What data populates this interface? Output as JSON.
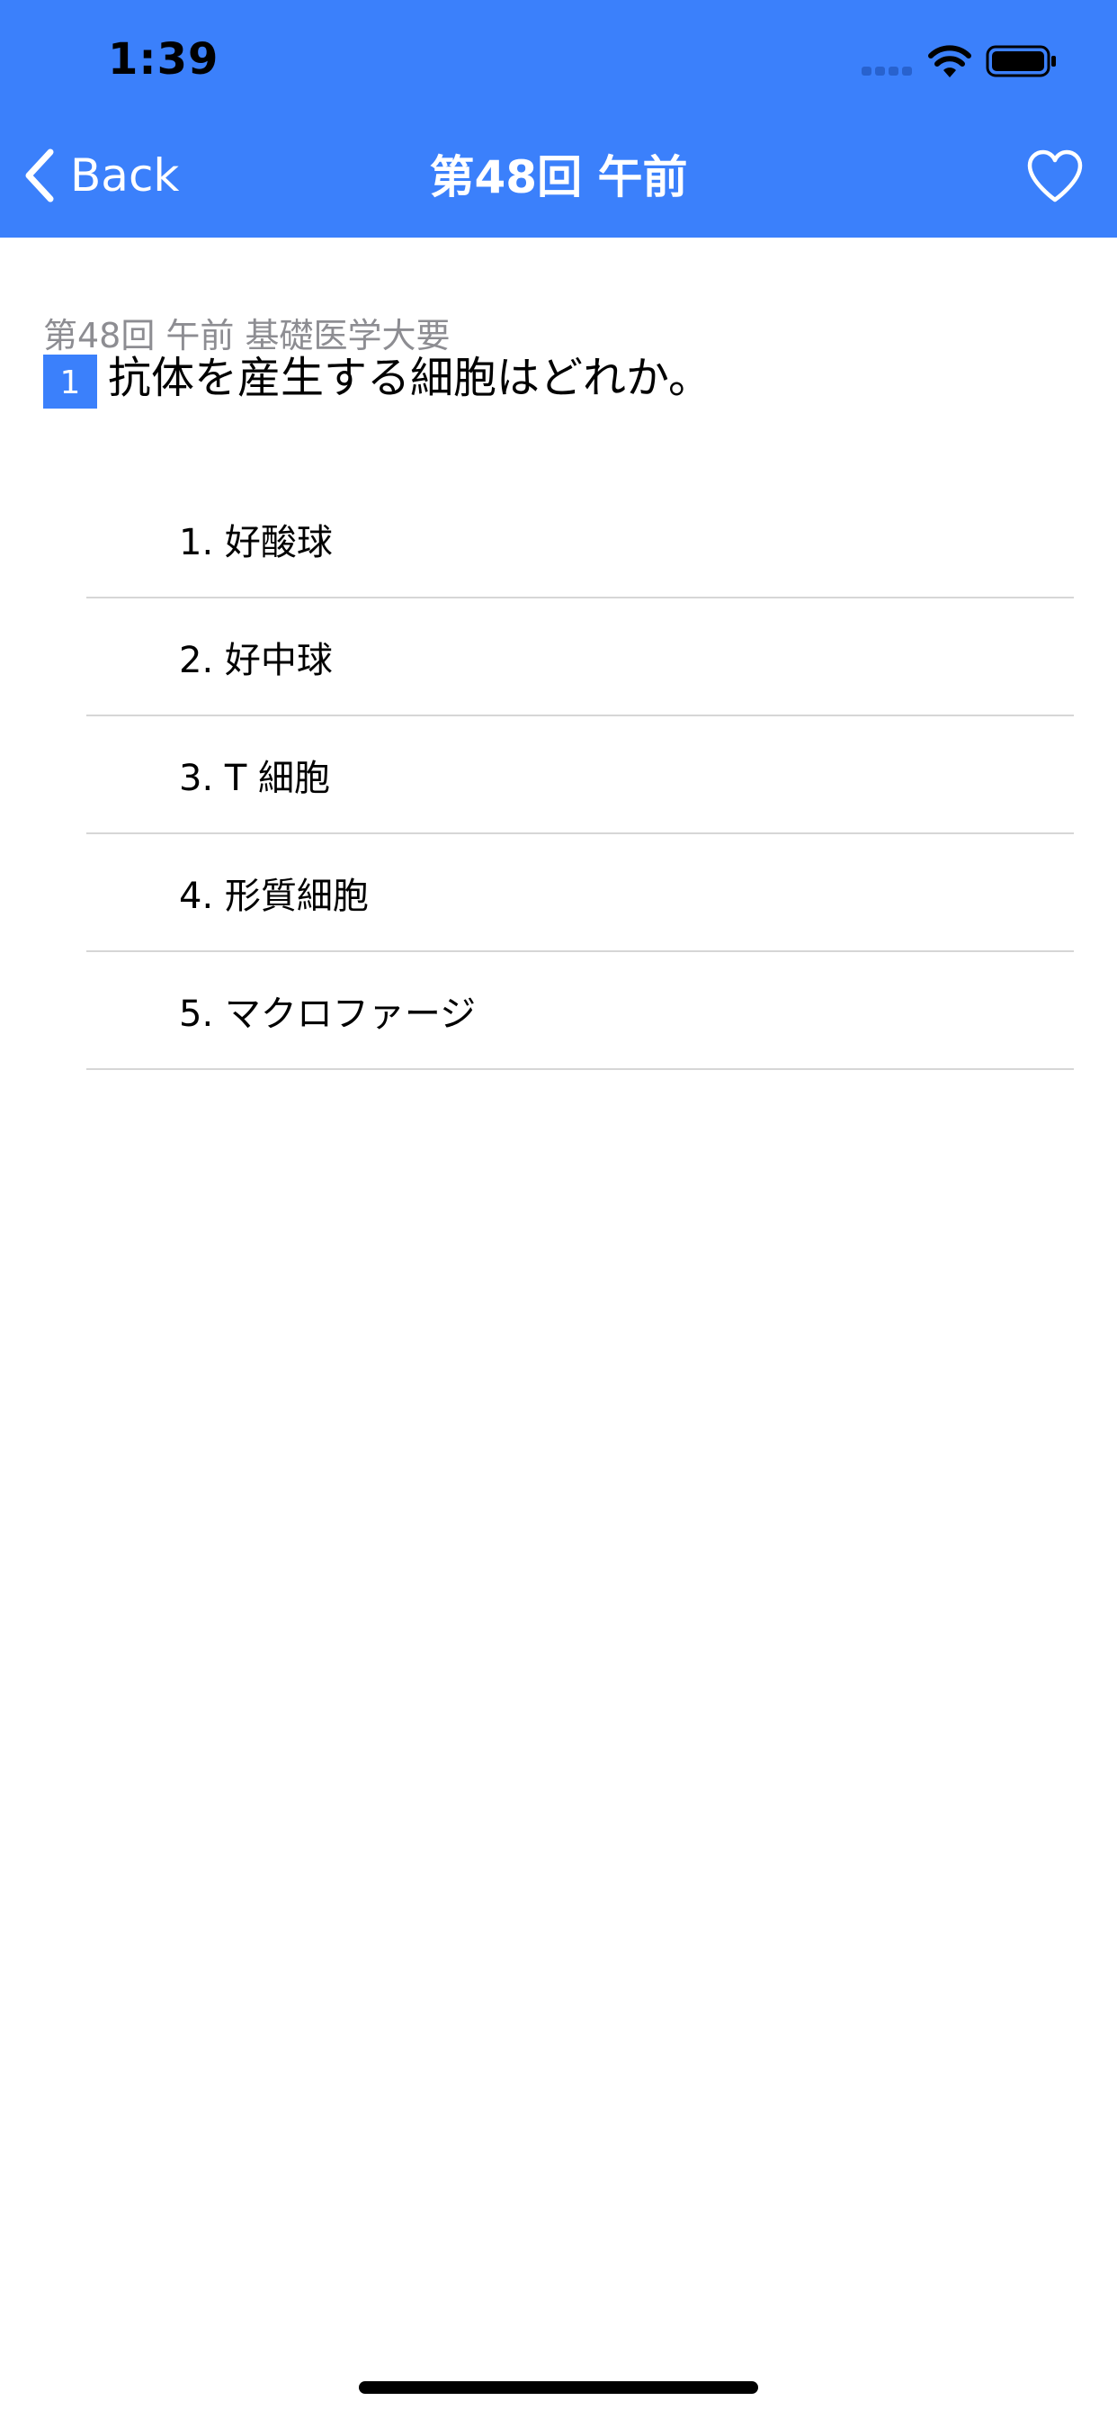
{
  "status_bar": {
    "time": "1:39"
  },
  "nav": {
    "back_label": "Back",
    "title": "第48回 午前",
    "favorite_icon": "heart-outline-icon"
  },
  "question": {
    "meta": "第48回 午前 基礎医学大要",
    "number": "1",
    "text": "抗体を産生する細胞はどれか。"
  },
  "choices": [
    {
      "label": "1. 好酸球"
    },
    {
      "label": "2. 好中球"
    },
    {
      "label": "3. T 細胞"
    },
    {
      "label": "4. 形質細胞"
    },
    {
      "label": "5. マクロファージ"
    }
  ],
  "colors": {
    "accent": "#3b80fb",
    "meta_text": "#8d8d92",
    "divider": "#d6d6d6"
  }
}
